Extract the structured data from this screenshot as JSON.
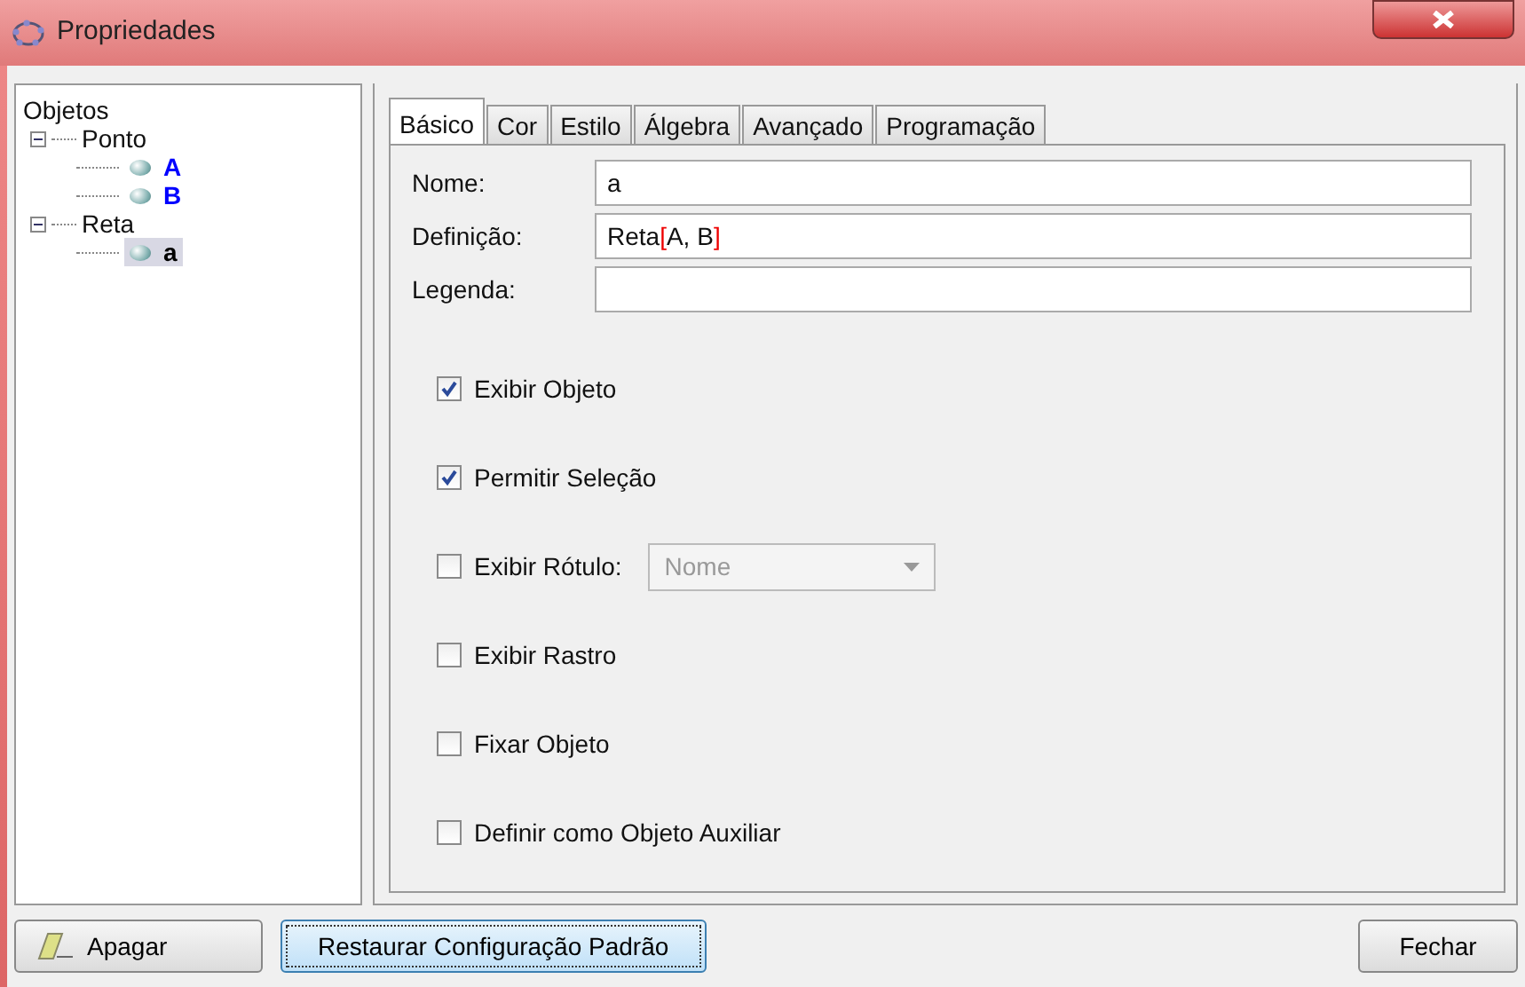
{
  "window": {
    "title": "Propriedades"
  },
  "tree": {
    "label": "Objetos",
    "children": [
      {
        "label": "Ponto",
        "expanded": true,
        "children": [
          {
            "label": "A",
            "color": "#0000ff",
            "selected": false
          },
          {
            "label": "B",
            "color": "#0000ff",
            "selected": false
          }
        ]
      },
      {
        "label": "Reta",
        "expanded": true,
        "children": [
          {
            "label": "a",
            "color": "#000000",
            "selected": true
          }
        ]
      }
    ]
  },
  "tabs": [
    {
      "label": "Básico",
      "selected": true
    },
    {
      "label": "Cor",
      "selected": false
    },
    {
      "label": "Estilo",
      "selected": false
    },
    {
      "label": "Álgebra",
      "selected": false
    },
    {
      "label": "Avançado",
      "selected": false
    },
    {
      "label": "Programação",
      "selected": false
    }
  ],
  "fields": [
    {
      "label": "Nome:",
      "segments": [
        {
          "kind": "text",
          "text": "a"
        }
      ]
    },
    {
      "label": "Definição:",
      "segments": [
        {
          "kind": "text",
          "text": "Reta"
        },
        {
          "kind": "bracket",
          "text": "["
        },
        {
          "kind": "text",
          "text": "A, B"
        },
        {
          "kind": "bracket",
          "text": "]"
        }
      ]
    },
    {
      "label": "Legenda:"
    }
  ],
  "options": [
    {
      "kind": "checkbox",
      "label": "Exibir Objeto",
      "checked": true
    },
    {
      "kind": "checkbox",
      "label": "Permitir Seleção",
      "checked": true
    },
    {
      "kind": "checkbox_dropdown",
      "label": "Exibir Rótulo:",
      "checked": false,
      "dropdown": {
        "value": "Nome",
        "disabled": true
      }
    },
    {
      "kind": "checkbox",
      "label": "Exibir Rastro",
      "checked": false
    },
    {
      "kind": "checkbox",
      "label": "Fixar Objeto",
      "checked": false
    },
    {
      "kind": "checkbox",
      "label": "Definir como Objeto Auxiliar",
      "checked": false
    }
  ],
  "buttons": [
    {
      "kind": "eraser",
      "label": "Apagar",
      "focused": false
    },
    {
      "kind": "plain",
      "label": "Restaurar Configuração Padrão",
      "focused": true
    },
    {
      "kind": "plain",
      "label": "Fechar",
      "focused": false
    }
  ]
}
